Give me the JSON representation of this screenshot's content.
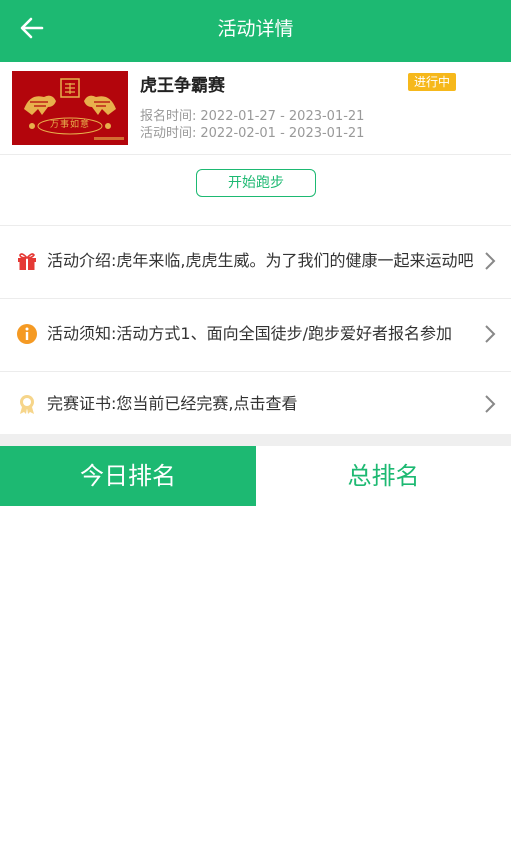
{
  "header": {
    "title": "活动详情"
  },
  "activity": {
    "banner_text": "万事如意",
    "title": "虎王争霸赛",
    "status": "进行中",
    "signup_label": "报名时间:",
    "signup_range": "2022-01-27 - 2023-01-21",
    "event_label": "活动时间:",
    "event_range": "2022-02-01 - 2023-01-21",
    "start_button": "开始跑步"
  },
  "rows": [
    {
      "icon": "gift-icon",
      "text": "活动介绍:虎年来临,虎虎生威。为了我们的健康一起来运动吧"
    },
    {
      "icon": "info-icon",
      "text": "活动须知:活动方式1、面向全国徒步/跑步爱好者报名参加"
    },
    {
      "icon": "certificate-icon",
      "text": "完赛证书:您当前已经完赛,点击查看"
    }
  ],
  "tabs": {
    "today": "今日排名",
    "total": "总排名"
  },
  "colors": {
    "brand": "#1db972",
    "badge": "#f6b81b",
    "banner": "#b3050c"
  }
}
